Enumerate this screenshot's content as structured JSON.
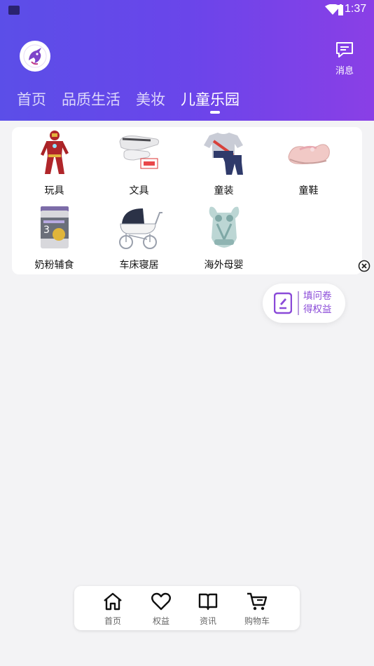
{
  "status": {
    "time": "1:37"
  },
  "header": {
    "message_label": "消息",
    "tabs": [
      {
        "label": "首页",
        "active": false
      },
      {
        "label": "品质生活",
        "active": false
      },
      {
        "label": "美妆",
        "active": false
      },
      {
        "label": "儿童乐园",
        "active": true
      }
    ]
  },
  "categories": [
    {
      "label": "玩具",
      "icon": "toy-figure-icon"
    },
    {
      "label": "文具",
      "icon": "stationery-icon"
    },
    {
      "label": "童装",
      "icon": "kids-clothing-icon"
    },
    {
      "label": "童鞋",
      "icon": "kids-shoes-icon"
    },
    {
      "label": "奶粉辅食",
      "icon": "milk-powder-icon"
    },
    {
      "label": "车床寝居",
      "icon": "stroller-icon"
    },
    {
      "label": "海外母婴",
      "icon": "baby-carrier-icon"
    }
  ],
  "survey": {
    "line1": "填问卷",
    "line2": "得权益"
  },
  "bottom_nav": [
    {
      "label": "首页",
      "icon": "home-icon"
    },
    {
      "label": "权益",
      "icon": "heart-icon"
    },
    {
      "label": "资讯",
      "icon": "book-icon"
    },
    {
      "label": "购物车",
      "icon": "cart-icon"
    }
  ],
  "colors": {
    "header_start": "#5b4ee8",
    "header_end": "#8a3fe6",
    "survey_text": "#8a4ad8"
  }
}
